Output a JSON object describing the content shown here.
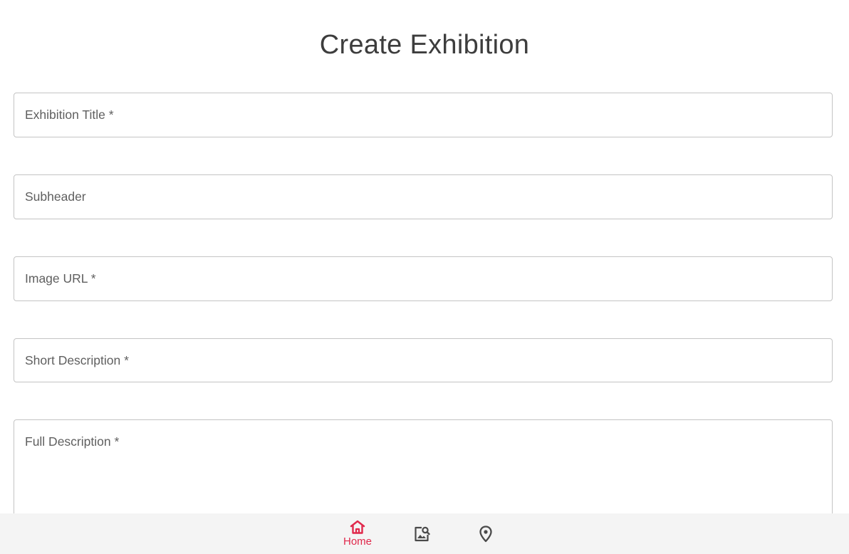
{
  "page": {
    "title": "Create Exhibition"
  },
  "form": {
    "fields": [
      {
        "label": "Exhibition Title *"
      },
      {
        "label": "Subheader"
      },
      {
        "label": "Image URL *"
      },
      {
        "label": "Short Description *"
      },
      {
        "label": "Full Description *"
      }
    ]
  },
  "bottom_nav": {
    "items": [
      {
        "label": "Home",
        "icon": "home-icon",
        "active": true
      },
      {
        "label": "",
        "icon": "image-search-icon",
        "active": false
      },
      {
        "label": "",
        "icon": "location-pin-icon",
        "active": false
      }
    ],
    "active_color": "#e0284b",
    "inactive_color": "#4a4a4a",
    "background": "#f4f4f4"
  }
}
